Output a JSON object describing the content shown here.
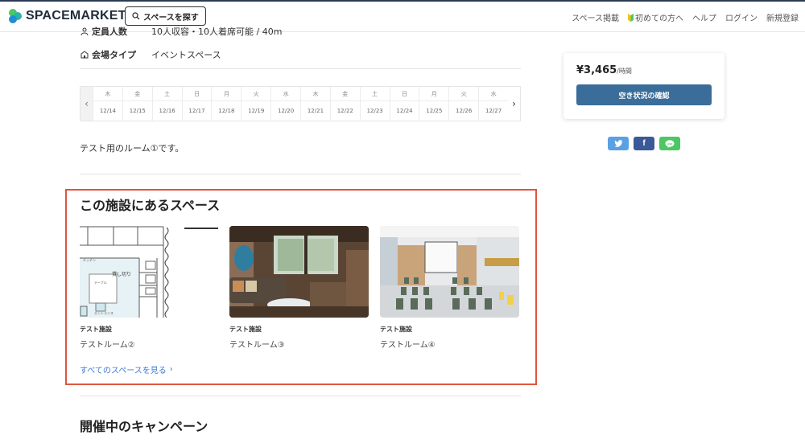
{
  "header": {
    "logo_text": "SPACEMARKET",
    "search_label": "スペースを探す",
    "nav": [
      "スペース掲載",
      "初めての方へ",
      "ヘルプ",
      "ログイン",
      "新規登録"
    ]
  },
  "info": {
    "capacity_label": "定員人数",
    "capacity_value": "10人収容・10人着席可能 / 40m",
    "venue_type_label": "会場タイプ",
    "venue_type_value": "イベントスペース"
  },
  "calendar": {
    "days": [
      {
        "dow": "木",
        "date": "12/14"
      },
      {
        "dow": "金",
        "date": "12/15"
      },
      {
        "dow": "土",
        "date": "12/16"
      },
      {
        "dow": "日",
        "date": "12/17"
      },
      {
        "dow": "月",
        "date": "12/18"
      },
      {
        "dow": "火",
        "date": "12/19"
      },
      {
        "dow": "水",
        "date": "12/20"
      },
      {
        "dow": "木",
        "date": "12/21"
      },
      {
        "dow": "金",
        "date": "12/22"
      },
      {
        "dow": "土",
        "date": "12/23"
      },
      {
        "dow": "日",
        "date": "12/24"
      },
      {
        "dow": "月",
        "date": "12/25"
      },
      {
        "dow": "火",
        "date": "12/26"
      },
      {
        "dow": "水",
        "date": "12/27"
      }
    ]
  },
  "description": "テスト用のルーム①です。",
  "spaces": {
    "title": "この施設にあるスペース",
    "cards": [
      {
        "facility": "テスト施設",
        "room": "テストルーム②"
      },
      {
        "facility": "テスト施設",
        "room": "テストルーム③"
      },
      {
        "facility": "テスト施設",
        "room": "テストルーム④"
      }
    ],
    "floorplan_labels": [
      "貸し切り",
      "キッチン",
      "テーブル",
      "エントランス"
    ],
    "see_all": "すべてのスペースを見る"
  },
  "campaign": {
    "title": "開催中のキャンペーン"
  },
  "booking": {
    "price": "¥3,465",
    "price_unit": "/時間",
    "availability_button": "空き状況の確認"
  },
  "share": {
    "line_label": "LINE"
  },
  "colors": {
    "accent": "#3a6d99",
    "highlight": "#e0553f",
    "twitter": "#5aa1e3",
    "facebook": "#3b5998",
    "line": "#4cc764"
  }
}
